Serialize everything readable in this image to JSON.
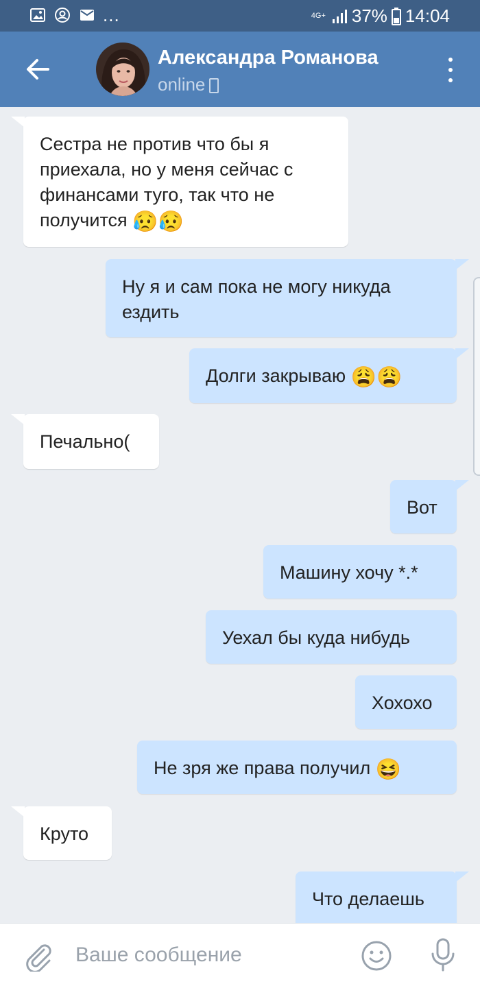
{
  "status_bar": {
    "dots": "...",
    "network": "4G+",
    "battery": "37%",
    "time": "14:04"
  },
  "header": {
    "contact_name": "Александра Романова",
    "status": "online"
  },
  "messages": [
    {
      "direction": "in",
      "text": "Сестра не против что бы я приехала, но у меня сейчас с финансами туго, так что не получится",
      "emoji": "😥😥"
    },
    {
      "direction": "out",
      "text": "Ну я и сам пока не могу никуда ездить",
      "emoji": ""
    },
    {
      "direction": "out",
      "text": "Долги закрываю",
      "emoji": "😩😩"
    },
    {
      "direction": "in",
      "text": "Печально(",
      "emoji": ""
    },
    {
      "direction": "out",
      "text": "Вот",
      "emoji": ""
    },
    {
      "direction": "out",
      "text": "Машину хочу *.*",
      "emoji": ""
    },
    {
      "direction": "out",
      "text": "Уехал бы куда нибудь",
      "emoji": ""
    },
    {
      "direction": "out",
      "text": "Хохохо",
      "emoji": ""
    },
    {
      "direction": "out",
      "text": "Не зря же права получил",
      "emoji": "😆"
    },
    {
      "direction": "in",
      "text": "Круто",
      "emoji": ""
    },
    {
      "direction": "out",
      "text": "Что делаешь",
      "emoji": ""
    }
  ],
  "composer": {
    "placeholder": "Ваше сообщение"
  },
  "colors": {
    "header": "#5181b8",
    "status_bar": "#3e5f86",
    "background": "#ebeef2",
    "outgoing_bubble": "#cce4ff",
    "incoming_bubble": "#ffffff"
  }
}
